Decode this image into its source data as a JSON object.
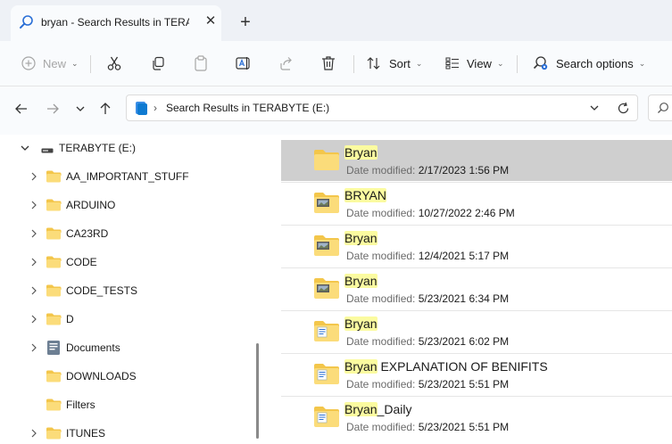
{
  "window": {
    "tab_title": "bryan - Search Results in TERA",
    "close_glyph": "✕",
    "new_tab_glyph": "+"
  },
  "toolbar": {
    "new_label": "New",
    "sort_label": "Sort",
    "view_label": "View",
    "search_options_label": "Search options"
  },
  "address": {
    "path": "Search Results in TERABYTE (E:)"
  },
  "nav_tree": {
    "drive_label": "TERABYTE (E:)",
    "items": [
      {
        "label": "AA_IMPORTANT_STUFF",
        "icon": "folder-icon",
        "expandable": true
      },
      {
        "label": "ARDUINO",
        "icon": "folder-icon",
        "expandable": true
      },
      {
        "label": "CA23RD",
        "icon": "folder-icon",
        "expandable": true
      },
      {
        "label": "CODE",
        "icon": "folder-icon",
        "expandable": true
      },
      {
        "label": "CODE_TESTS",
        "icon": "folder-icon",
        "expandable": true
      },
      {
        "label": "D",
        "icon": "folder-icon",
        "expandable": true
      },
      {
        "label": "Documents",
        "icon": "documents-icon",
        "expandable": true
      },
      {
        "label": "DOWNLOADS",
        "icon": "folder-icon",
        "expandable": false
      },
      {
        "label": "Filters",
        "icon": "folder-icon",
        "expandable": false
      },
      {
        "label": "ITUNES",
        "icon": "folder-icon",
        "expandable": true
      }
    ]
  },
  "results": {
    "modified_label": "Date modified:",
    "items": [
      {
        "match": "Bryan",
        "rest": "",
        "date": "2/17/2023 1:56 PM",
        "icon": "folder-icon",
        "selected": true
      },
      {
        "match": "BRYAN",
        "rest": "",
        "date": "10/27/2022 2:46 PM",
        "icon": "folder-pictures-icon",
        "selected": false
      },
      {
        "match": "Bryan",
        "rest": "",
        "date": "12/4/2021 5:17 PM",
        "icon": "folder-pictures-icon",
        "selected": false
      },
      {
        "match": "Bryan",
        "rest": "",
        "date": "5/23/2021 6:34 PM",
        "icon": "folder-pictures-icon",
        "selected": false
      },
      {
        "match": "Bryan",
        "rest": "",
        "date": "5/23/2021 6:02 PM",
        "icon": "folder-document-icon",
        "selected": false
      },
      {
        "match": "Bryan",
        "rest": " EXPLANATION OF BENIFITS",
        "date": "5/23/2021 5:51 PM",
        "icon": "folder-document-icon",
        "selected": false
      },
      {
        "match": "Bryan",
        "rest": "_Daily",
        "date": "5/23/2021 5:51 PM",
        "icon": "folder-document-icon",
        "selected": false
      }
    ]
  },
  "colors": {
    "folder": "#f3c64b",
    "folder_light": "#fbdc7a",
    "selection": "#cfcfcf",
    "highlight": "#fbfba0",
    "drive": "#0e7ad1"
  }
}
